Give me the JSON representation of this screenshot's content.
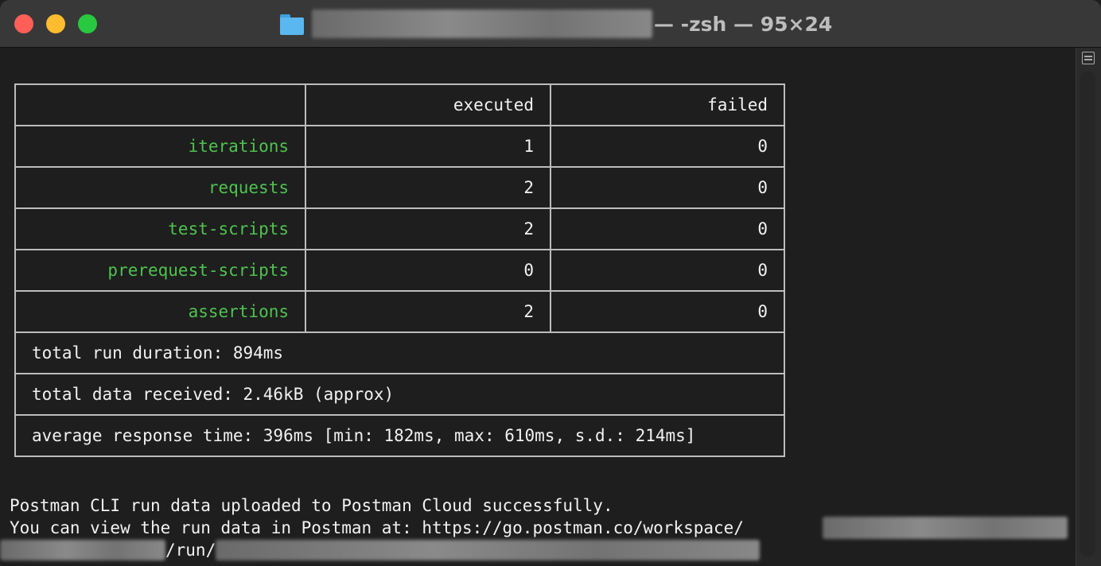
{
  "window": {
    "title_suffix": "— -zsh — 95×24",
    "icons": {
      "folder": "folder-icon",
      "scroll_toggle": "scroll-toggle-icon"
    }
  },
  "colors": {
    "label_green": "#4ec34e",
    "text": "#f2f2f2",
    "border": "#bcbcbc",
    "background": "#1e1e1e"
  },
  "table": {
    "headers": [
      "",
      "executed",
      "failed"
    ],
    "rows": [
      {
        "label": "iterations",
        "executed": "1",
        "failed": "0"
      },
      {
        "label": "requests",
        "executed": "2",
        "failed": "0"
      },
      {
        "label": "test-scripts",
        "executed": "2",
        "failed": "0"
      },
      {
        "label": "prerequest-scripts",
        "executed": "0",
        "failed": "0"
      },
      {
        "label": "assertions",
        "executed": "2",
        "failed": "0"
      }
    ],
    "summary": [
      "total run duration: 894ms",
      "total data received: 2.46kB (approx)",
      "average response time: 396ms [min: 182ms, max: 610ms, s.d.: 214ms]"
    ]
  },
  "output": {
    "line1": "Postman CLI run data uploaded to Postman Cloud successfully.",
    "line2": "You can view the run data in Postman at: https://go.postman.co/workspace/",
    "line3_mid": "/run/"
  }
}
